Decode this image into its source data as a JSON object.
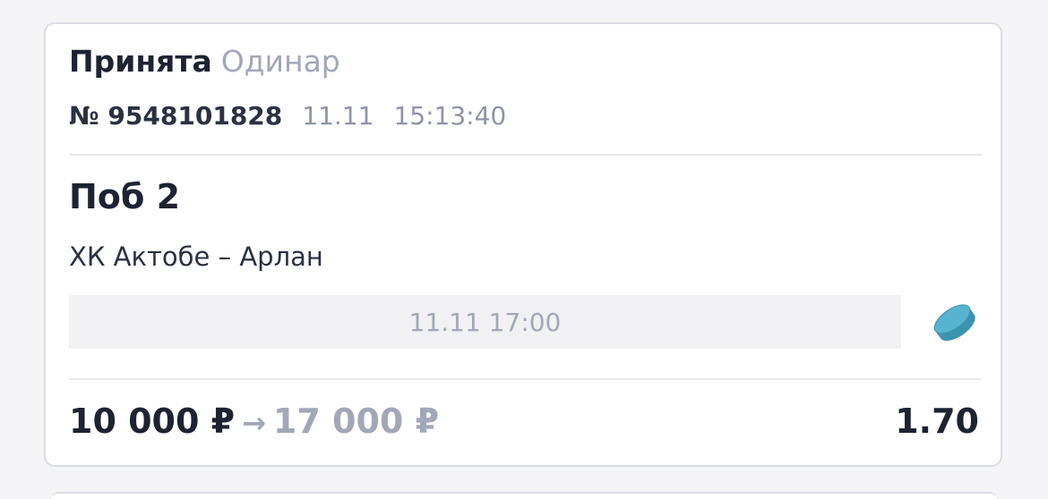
{
  "bet": {
    "status": "Принята",
    "type": "Одинар",
    "number": "№ 9548101828",
    "date": "11.11",
    "time": "15:13:40",
    "outcome": "Поб 2",
    "match": "ХК Актобе – Арлан",
    "event_datetime": "11.11 17:00",
    "sport_icon": "hockey-puck-icon",
    "stake": "10 000 ₽",
    "arrow": "→",
    "payout": "17 000 ₽",
    "odds": "1.70"
  },
  "colors": {
    "background": "#f4f4f6",
    "card": "#ffffff",
    "primary_text": "#1d2333",
    "muted_text": "#a2a7b8",
    "puck": "#4aa6c4"
  }
}
